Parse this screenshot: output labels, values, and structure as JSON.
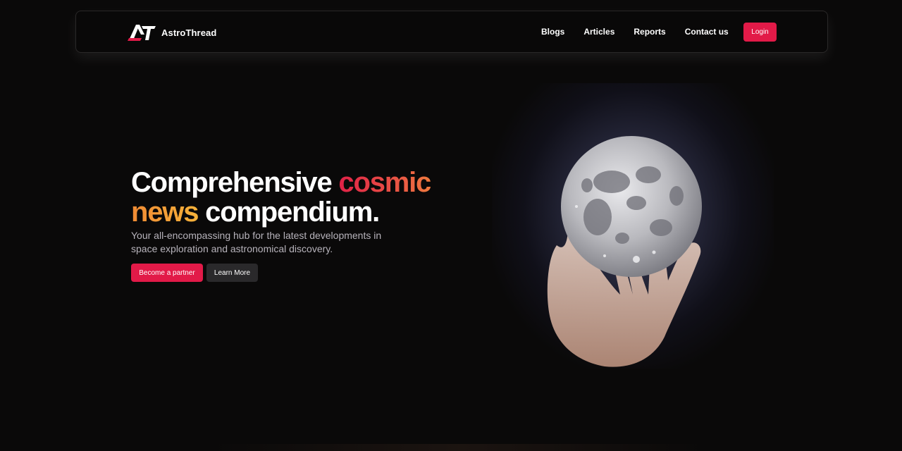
{
  "brand": {
    "name": "AstroThread",
    "logo_icon": "astrothread-logo-icon"
  },
  "nav": {
    "links": [
      "Blogs",
      "Articles",
      "Reports",
      "Contact us"
    ],
    "login_label": "Login"
  },
  "hero": {
    "title_part1": "Comprehensive ",
    "title_highlight1": "cosmic",
    "title_highlight2": "news",
    "title_part2": " compendium.",
    "subtitle": "Your all-encompassing hub for the latest developments in space exploration and astronomical discovery.",
    "primary_button": "Become a partner",
    "secondary_button": "Learn More",
    "image_icon": "moon-in-hand-illustration"
  },
  "colors": {
    "background": "#0a0909",
    "accent": "#e21a48",
    "gradient_red": "#e02147",
    "gradient_orange": "#f6b23a",
    "secondary_button": "#2a292b"
  }
}
